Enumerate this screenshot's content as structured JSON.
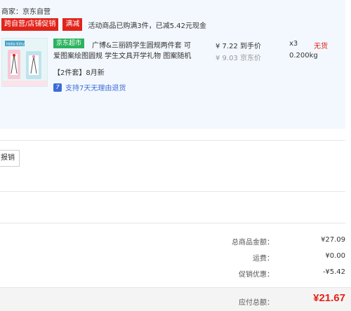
{
  "merchant": {
    "label": "商家：京东自营"
  },
  "promo": {
    "tag_primary": "跨自营/店铺促销",
    "tag_secondary": "满减",
    "text": "活动商品已购满3件，已减5.42元现金"
  },
  "product": {
    "badge": "京东超市",
    "title_line1": "广博&三丽鸥学生圆规两件套 可",
    "title_line2": "爱图案绘图圆规 学生文具开学礼物 图案随机",
    "spec": "【2件套】8月新",
    "return_icon": "7",
    "return_text": "支持7天无理由退货",
    "price_main": "¥ 7.22 到手价",
    "price_jd": "¥ 9.03 京东价",
    "quantity": "x3",
    "weight": "0.200kg",
    "stock_status": "无货",
    "thumb_banner": "Hello Kitty"
  },
  "actions": {
    "reimburse_label": "报销"
  },
  "summary": {
    "total_label": "总商品金额：",
    "total_value": "¥27.09",
    "shipping_label": "运费：",
    "shipping_value": "¥0.00",
    "discount_label": "促销优惠：",
    "discount_value": "-¥5.42",
    "payable_label": "应付总额：",
    "payable_value": "¥21.67"
  },
  "colors": {
    "accent_red": "#e2231a",
    "jd_green": "#2bb35e",
    "link_blue": "#3d6bd8",
    "block_bg": "#f3f8fe"
  },
  "icons": {
    "product_image": "compass-set-thumbnail",
    "return_policy": "return-7day-icon"
  }
}
